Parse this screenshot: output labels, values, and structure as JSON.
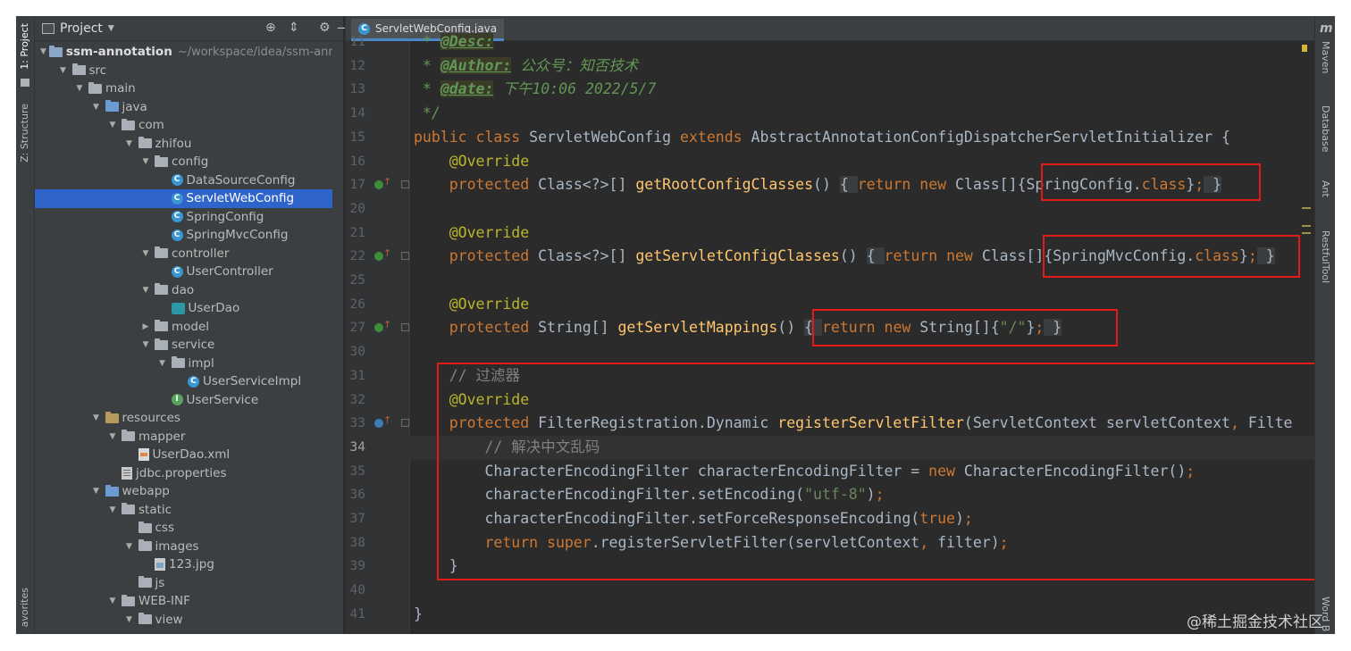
{
  "left_strip": {
    "project_tab": "1: Project",
    "structure_tab": "Z: Structure",
    "favorites_tab": "avorites"
  },
  "project_panel": {
    "title": "Project",
    "tree": [
      {
        "label": "ssm-annotation",
        "hint": "~/workspace/idea/ssm-anno",
        "depth": 0,
        "arrow": "down",
        "icon": "module-folder",
        "bold": true
      },
      {
        "label": "src",
        "depth": 1,
        "arrow": "down",
        "icon": "folder"
      },
      {
        "label": "main",
        "depth": 2,
        "arrow": "down",
        "icon": "folder"
      },
      {
        "label": "java",
        "depth": 3,
        "arrow": "down",
        "icon": "blue-folder"
      },
      {
        "label": "com",
        "depth": 4,
        "arrow": "down",
        "icon": "folder"
      },
      {
        "label": "zhifou",
        "depth": 5,
        "arrow": "down",
        "icon": "folder"
      },
      {
        "label": "config",
        "depth": 6,
        "arrow": "down",
        "icon": "folder"
      },
      {
        "label": "DataSourceConfig",
        "depth": 7,
        "arrow": "none",
        "icon": "class"
      },
      {
        "label": "ServletWebConfig",
        "depth": 7,
        "arrow": "none",
        "icon": "class",
        "selected": true
      },
      {
        "label": "SpringConfig",
        "depth": 7,
        "arrow": "none",
        "icon": "class"
      },
      {
        "label": "SpringMvcConfig",
        "depth": 7,
        "arrow": "none",
        "icon": "class"
      },
      {
        "label": "controller",
        "depth": 6,
        "arrow": "down",
        "icon": "folder"
      },
      {
        "label": "UserController",
        "depth": 7,
        "arrow": "none",
        "icon": "class"
      },
      {
        "label": "dao",
        "depth": 6,
        "arrow": "down",
        "icon": "folder"
      },
      {
        "label": "UserDao",
        "depth": 7,
        "arrow": "none",
        "icon": "dao"
      },
      {
        "label": "model",
        "depth": 6,
        "arrow": "right",
        "icon": "folder"
      },
      {
        "label": "service",
        "depth": 6,
        "arrow": "down",
        "icon": "folder"
      },
      {
        "label": "impl",
        "depth": 7,
        "arrow": "down",
        "icon": "folder"
      },
      {
        "label": "UserServiceImpl",
        "depth": 8,
        "arrow": "none",
        "icon": "class"
      },
      {
        "label": "UserService",
        "depth": 7,
        "arrow": "none",
        "icon": "interface"
      },
      {
        "label": "resources",
        "depth": 3,
        "arrow": "down",
        "icon": "res-folder"
      },
      {
        "label": "mapper",
        "depth": 4,
        "arrow": "down",
        "icon": "folder"
      },
      {
        "label": "UserDao.xml",
        "depth": 5,
        "arrow": "none",
        "icon": "xml"
      },
      {
        "label": "jdbc.properties",
        "depth": 4,
        "arrow": "none",
        "icon": "properties"
      },
      {
        "label": "webapp",
        "depth": 3,
        "arrow": "down",
        "icon": "blue-folder"
      },
      {
        "label": "static",
        "depth": 4,
        "arrow": "down",
        "icon": "folder"
      },
      {
        "label": "css",
        "depth": 5,
        "arrow": "none",
        "icon": "folder"
      },
      {
        "label": "images",
        "depth": 5,
        "arrow": "down",
        "icon": "folder"
      },
      {
        "label": "123.jpg",
        "depth": 6,
        "arrow": "none",
        "icon": "image"
      },
      {
        "label": "js",
        "depth": 5,
        "arrow": "none",
        "icon": "folder"
      },
      {
        "label": "WEB-INF",
        "depth": 4,
        "arrow": "down",
        "icon": "folder"
      },
      {
        "label": "view",
        "depth": 5,
        "arrow": "down",
        "icon": "folder"
      }
    ]
  },
  "editor": {
    "tab_label": "ServletWebConfig.java",
    "current_line": "34",
    "lines": [
      {
        "num": "11",
        "segs": [
          [
            "doc",
            " * "
          ],
          [
            "doc-tag",
            "@Desc:"
          ]
        ]
      },
      {
        "num": "12",
        "segs": [
          [
            "doc",
            " * "
          ],
          [
            "doc-tag",
            "@Author:"
          ],
          [
            "doc",
            " 公众号：知否技术"
          ]
        ]
      },
      {
        "num": "13",
        "segs": [
          [
            "doc",
            " * "
          ],
          [
            "doc-tag",
            "@date:"
          ],
          [
            "doc",
            " 下午10:06 2022/5/7"
          ]
        ]
      },
      {
        "num": "14",
        "segs": [
          [
            "doc",
            " */"
          ]
        ]
      },
      {
        "num": "15",
        "segs": [
          [
            "kw",
            "public class "
          ],
          [
            "plain",
            "ServletWebConfig "
          ],
          [
            "kw",
            "extends "
          ],
          [
            "plain",
            "AbstractAnnotationConfigDispatcherServletInitializer {"
          ]
        ]
      },
      {
        "num": "16",
        "segs": [
          [
            "ann",
            "    @Override"
          ]
        ]
      },
      {
        "num": "17",
        "mark": "green",
        "segs": [
          [
            "kw",
            "    protected "
          ],
          [
            "plain",
            "Class<?>[] "
          ],
          [
            "fn",
            "getRootConfigClasses"
          ],
          [
            "plain",
            "() "
          ],
          [
            "box",
            "{ "
          ],
          [
            "kw",
            "return new "
          ],
          [
            "plain",
            "Class[]{SpringConfig."
          ],
          [
            "kw",
            "class"
          ],
          [
            "plain",
            "}"
          ],
          [
            "kw",
            ";"
          ],
          [
            "box",
            " }"
          ]
        ]
      },
      {
        "num": "20",
        "segs": []
      },
      {
        "num": "21",
        "segs": [
          [
            "ann",
            "    @Override"
          ]
        ]
      },
      {
        "num": "22",
        "mark": "green",
        "segs": [
          [
            "kw",
            "    protected "
          ],
          [
            "plain",
            "Class<?>[] "
          ],
          [
            "fn",
            "getServletConfigClasses"
          ],
          [
            "plain",
            "() "
          ],
          [
            "box",
            "{ "
          ],
          [
            "kw",
            "return new "
          ],
          [
            "plain",
            "Class[]{SpringMvcConfig."
          ],
          [
            "kw",
            "class"
          ],
          [
            "plain",
            "}"
          ],
          [
            "kw",
            ";"
          ],
          [
            "box",
            " }"
          ]
        ]
      },
      {
        "num": "25",
        "segs": []
      },
      {
        "num": "26",
        "segs": [
          [
            "ann",
            "    @Override"
          ]
        ]
      },
      {
        "num": "27",
        "mark": "green",
        "segs": [
          [
            "kw",
            "    protected "
          ],
          [
            "plain",
            "String[] "
          ],
          [
            "fn",
            "getServletMappings"
          ],
          [
            "plain",
            "() "
          ],
          [
            "box",
            "{ "
          ],
          [
            "kw",
            "return new "
          ],
          [
            "plain",
            "String[]{"
          ],
          [
            "str",
            "\"/\""
          ],
          [
            "plain",
            "}"
          ],
          [
            "kw",
            ";"
          ],
          [
            "box",
            " }"
          ]
        ]
      },
      {
        "num": "30",
        "segs": []
      },
      {
        "num": "31",
        "segs": [
          [
            "cmt",
            "    // 过滤器"
          ]
        ]
      },
      {
        "num": "32",
        "segs": [
          [
            "ann",
            "    @Override"
          ]
        ]
      },
      {
        "num": "33",
        "mark": "blue",
        "segs": [
          [
            "kw",
            "    protected "
          ],
          [
            "plain",
            "FilterRegistration.Dynamic "
          ],
          [
            "fn",
            "registerServletFilter"
          ],
          [
            "plain",
            "(ServletContext servletContext"
          ],
          [
            "kw",
            ", "
          ],
          [
            "plain",
            "Filte"
          ]
        ]
      },
      {
        "num": "34",
        "segs": [
          [
            "cmt",
            "        // 解决中文乱码"
          ]
        ]
      },
      {
        "num": "35",
        "segs": [
          [
            "plain",
            "        CharacterEncodingFilter characterEncodingFilter = "
          ],
          [
            "kw",
            "new "
          ],
          [
            "plain",
            "CharacterEncodingFilter()"
          ],
          [
            "kw",
            ";"
          ]
        ]
      },
      {
        "num": "36",
        "segs": [
          [
            "plain",
            "        characterEncodingFilter.setEncoding("
          ],
          [
            "str",
            "\"utf-8\""
          ],
          [
            "plain",
            ")"
          ],
          [
            "kw",
            ";"
          ]
        ]
      },
      {
        "num": "37",
        "segs": [
          [
            "plain",
            "        characterEncodingFilter.setForceResponseEncoding("
          ],
          [
            "kw",
            "true"
          ],
          [
            "plain",
            ")"
          ],
          [
            "kw",
            ";"
          ]
        ]
      },
      {
        "num": "38",
        "segs": [
          [
            "kw",
            "        return super"
          ],
          [
            "plain",
            ".registerServletFilter(servletContext"
          ],
          [
            "kw",
            ", "
          ],
          [
            "plain",
            "filter)"
          ],
          [
            "kw",
            ";"
          ]
        ]
      },
      {
        "num": "39",
        "segs": [
          [
            "plain",
            "    }"
          ]
        ]
      },
      {
        "num": "40",
        "segs": []
      },
      {
        "num": "41",
        "segs": [
          [
            "plain",
            "}"
          ]
        ]
      }
    ]
  },
  "right_strip": {
    "m": "m",
    "maven": "Maven",
    "database": "Database",
    "ant": "Ant",
    "restful": "RestfulTool",
    "word": "Word B"
  },
  "watermark": "@稀土掘金技术社区",
  "colors": {
    "highlight_box": "#e21a1a",
    "selection": "#2f65ca",
    "keyword": "#cc7832",
    "method": "#ffc66d",
    "annotation": "#bbb529",
    "string": "#6a8759",
    "comment": "#808080",
    "doc": "#629755"
  }
}
